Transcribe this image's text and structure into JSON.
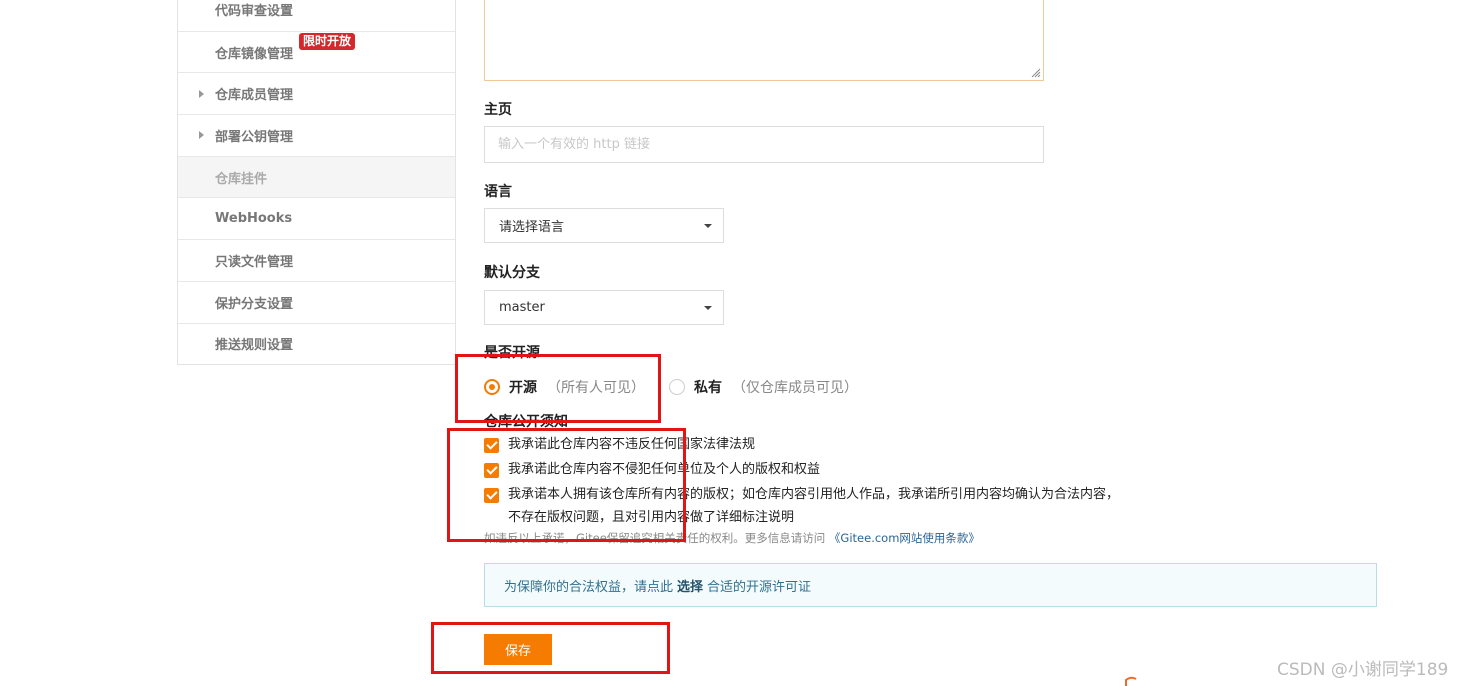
{
  "sidebar": {
    "items": [
      {
        "label": "代码审查设置"
      },
      {
        "label": "仓库镜像管理",
        "badge": "限时开放"
      },
      {
        "label": "仓库成员管理"
      },
      {
        "label": "部署公钥管理"
      },
      {
        "label": "仓库挂件"
      },
      {
        "label": "WebHooks"
      },
      {
        "label": "只读文件管理"
      },
      {
        "label": "保护分支设置"
      },
      {
        "label": "推送规则设置"
      }
    ]
  },
  "form": {
    "homepage_label": "主页",
    "homepage_placeholder": "输入一个有效的 http 链接",
    "language_label": "语言",
    "language_value": "请选择语言",
    "branch_label": "默认分支",
    "branch_value": "master",
    "opensource_label": "是否开源",
    "open_label": "开源",
    "open_note": "（所有人可见）",
    "private_label": "私有",
    "private_note": "（仅仓库成员可见）",
    "notice_label": "仓库公开须知",
    "checks": [
      "我承诺此仓库内容不违反任何国家法律法规",
      "我承诺此仓库内容不侵犯任何单位及个人的版权和权益",
      "我承诺本人拥有该仓库所有内容的版权；如仓库内容引用他人作品，我承诺所引用内容均确认为合法内容，",
      "不存在版权问题，且对引用内容做了详细标注说明"
    ],
    "note_text": "如违反以上承诺，Gitee保留追究相关责任的权利。更多信息请访问",
    "note_link": "《Gitee.com网站使用条款》",
    "info_prefix": "为保障你的合法权益，请点此",
    "info_link": "选择",
    "info_suffix": "合适的开源许可证",
    "save_label": "保存"
  },
  "watermark": "CSDN @小谢同学189",
  "colors": {
    "accent": "#f57c00",
    "highlight": "#e01515",
    "badge": "#d3292b"
  }
}
